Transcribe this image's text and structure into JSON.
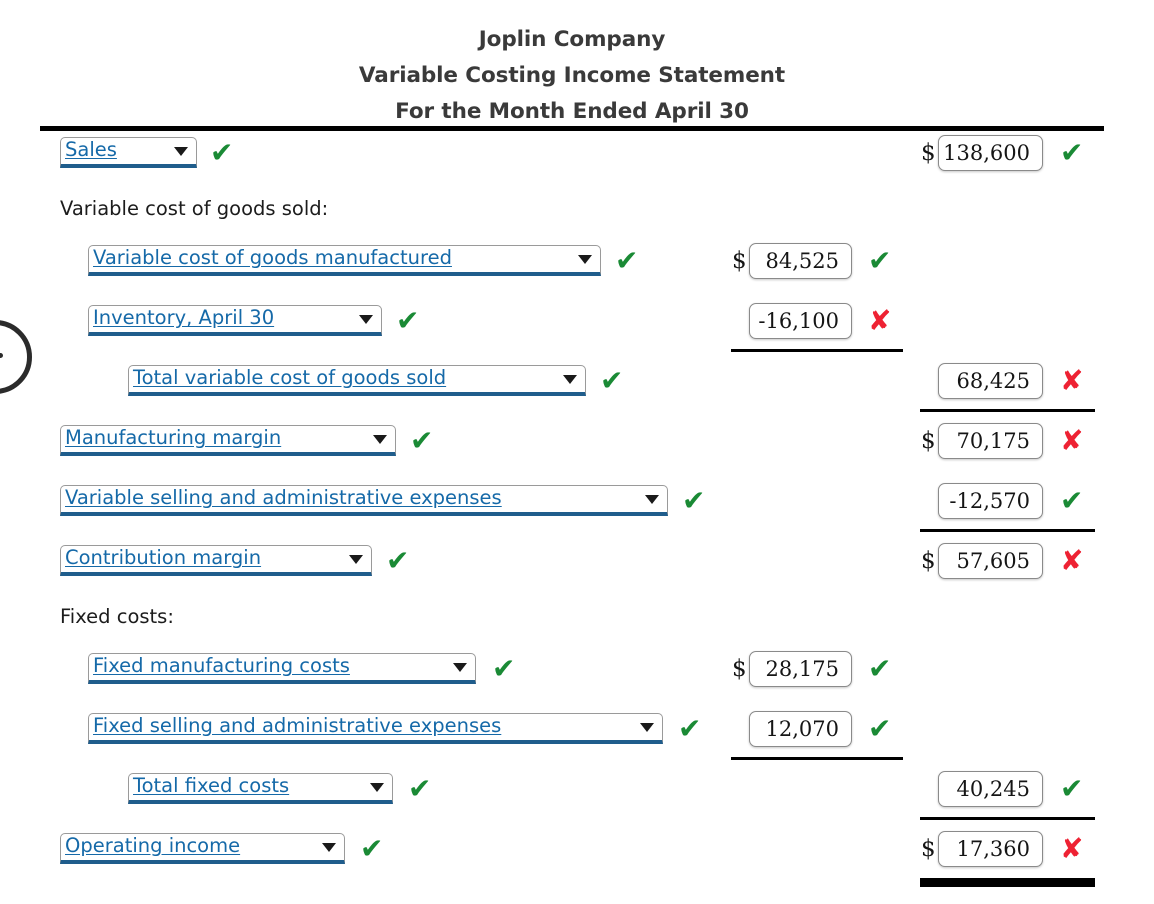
{
  "header": {
    "company": "Joplin Company",
    "statement": "Variable Costing Income Statement",
    "period": "For the Month Ended April 30"
  },
  "symbols": {
    "dollar": "$",
    "check": "✔",
    "cross": "✘"
  },
  "rows": [
    {
      "id": "sales",
      "label": "Sales",
      "label_kind": "select",
      "label_mark": "correct",
      "right_dollar": true,
      "right_value": "138,600",
      "right_mark": "correct"
    },
    {
      "id": "variable-cogs-heading",
      "label": "Variable cost of goods sold:",
      "label_kind": "text"
    },
    {
      "id": "variable-cost-of-goods-manufactured",
      "label": "Variable cost of goods manufactured",
      "label_kind": "select",
      "label_mark": "correct",
      "mid_dollar": true,
      "mid_value": "84,525",
      "mid_mark": "correct"
    },
    {
      "id": "inventory-april-30",
      "label": "Inventory, April 30",
      "label_kind": "select",
      "label_mark": "correct",
      "mid_dollar": false,
      "mid_value": "-16,100",
      "mid_mark": "incorrect"
    },
    {
      "id": "total-variable-cost-of-goods-sold",
      "label": "Total variable cost of goods sold",
      "label_kind": "select",
      "label_mark": "correct",
      "right_dollar": false,
      "right_value": "68,425",
      "right_mark": "incorrect"
    },
    {
      "id": "manufacturing-margin",
      "label": "Manufacturing margin",
      "label_kind": "select",
      "label_mark": "correct",
      "right_dollar": true,
      "right_value": "70,175",
      "right_mark": "incorrect"
    },
    {
      "id": "variable-selling-and-administrative-expenses",
      "label": "Variable selling and administrative expenses",
      "label_kind": "select",
      "label_mark": "correct",
      "right_dollar": false,
      "right_value": "-12,570",
      "right_mark": "correct"
    },
    {
      "id": "contribution-margin",
      "label": "Contribution margin",
      "label_kind": "select",
      "label_mark": "correct",
      "right_dollar": true,
      "right_value": "57,605",
      "right_mark": "incorrect"
    },
    {
      "id": "fixed-costs-heading",
      "label": "Fixed costs:",
      "label_kind": "text"
    },
    {
      "id": "fixed-manufacturing-costs",
      "label": "Fixed manufacturing costs",
      "label_kind": "select",
      "label_mark": "correct",
      "mid_dollar": true,
      "mid_value": "28,175",
      "mid_mark": "correct"
    },
    {
      "id": "fixed-selling-and-administrative-expenses",
      "label": "Fixed selling and administrative expenses",
      "label_kind": "select",
      "label_mark": "correct",
      "mid_dollar": false,
      "mid_value": "12,070",
      "mid_mark": "correct"
    },
    {
      "id": "total-fixed-costs",
      "label": "Total fixed costs",
      "label_kind": "select",
      "label_mark": "correct",
      "right_dollar": false,
      "right_value": "40,245",
      "right_mark": "correct"
    },
    {
      "id": "operating-income",
      "label": "Operating income",
      "label_kind": "select",
      "label_mark": "correct",
      "right_dollar": true,
      "right_value": "17,360",
      "right_mark": "incorrect"
    }
  ]
}
